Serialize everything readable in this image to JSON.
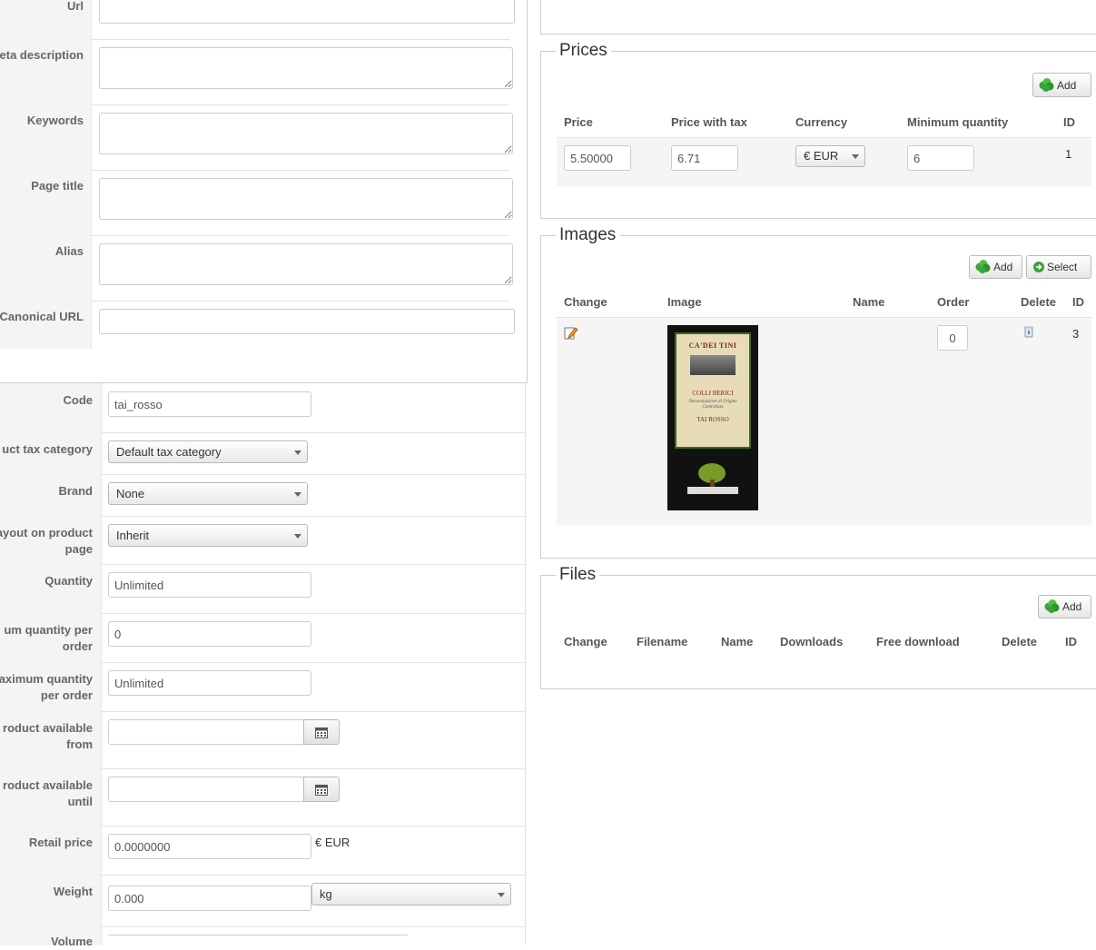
{
  "seo": {
    "url_label": "Url",
    "meta_description_label": "eta description",
    "keywords_label": "Keywords",
    "page_title_label": "Page title",
    "alias_label": "Alias",
    "canonical_url_label": "Canonical URL"
  },
  "product": {
    "code_label": "Code",
    "code_value": "tai_rosso",
    "tax_category_label": "uct tax category",
    "tax_category_value": "Default tax category",
    "brand_label": "Brand",
    "brand_value": "None",
    "layout_label_line1": "ayout on product",
    "layout_label_line2": "page",
    "layout_value": "Inherit",
    "quantity_label": "Quantity",
    "quantity_value": "Unlimited",
    "min_qty_label_line1": "um quantity per",
    "min_qty_label_line2": "order",
    "min_qty_value": "0",
    "max_qty_label_line1": "aximum quantity",
    "max_qty_label_line2": "per order",
    "max_qty_value": "Unlimited",
    "available_from_line1": "roduct available",
    "available_from_line2": "from",
    "available_until_line1": "roduct available",
    "available_until_line2": "until",
    "retail_price_label": "Retail price",
    "retail_price_value": "0.0000000",
    "retail_price_unit": "€ EUR",
    "weight_label": "Weight",
    "weight_value": "0.000",
    "weight_unit": "kg",
    "volume_label": "Volume"
  },
  "prices": {
    "legend": "Prices",
    "add_label": "Add",
    "headers": [
      "Price",
      "Price with tax",
      "Currency",
      "Minimum quantity",
      "ID"
    ],
    "row": {
      "price": "5.50000",
      "price_with_tax": "6.71",
      "currency": "€ EUR",
      "min_qty": "6",
      "id": "1"
    }
  },
  "images": {
    "legend": "Images",
    "add_label": "Add",
    "select_label": "Select",
    "headers": [
      "Change",
      "Image",
      "Name",
      "Order",
      "Delete",
      "ID"
    ],
    "row": {
      "order": "0",
      "id": "3"
    },
    "label_text": {
      "brand": "CA'DEI TINI",
      "region": "COLLI BERICI",
      "subtitle": "Denominazione di Origine Controllata",
      "wine": "TAI ROSSO"
    }
  },
  "files": {
    "legend": "Files",
    "add_label": "Add",
    "headers": [
      "Change",
      "Filename",
      "Name",
      "Downloads",
      "Free download",
      "Delete",
      "ID"
    ]
  },
  "colors": {
    "plus_green": "#3aa33a",
    "panel_border": "#cccccc",
    "label_bg": "#f4f4f4"
  }
}
